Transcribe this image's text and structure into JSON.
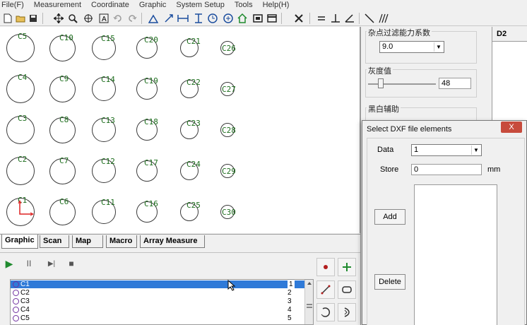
{
  "menu": [
    "File(F)",
    "Measurement",
    "Coordinate",
    "Graphic",
    "System Setup",
    "Tools",
    "Help(H)"
  ],
  "toolbar_icons": [
    "new-file-icon",
    "open-folder-icon",
    "save-icon",
    "move-icon",
    "zoom-icon",
    "fit-icon",
    "text-icon",
    "undo-icon",
    "redo-icon",
    "edit-point-icon",
    "align-icon",
    "distance-icon",
    "vertical-distance-icon",
    "rotate-icon",
    "mirror-icon",
    "home-icon",
    "rect-icon",
    "window-icon",
    "tools-icon",
    "line-icon",
    "perpendicular-icon",
    "angle-icon",
    "slash-icon",
    "parallel-icon"
  ],
  "canvas": {
    "labels": [
      "C5",
      "C10",
      "C15",
      "C20",
      "C21",
      "C26",
      "C4",
      "C9",
      "C14",
      "C19",
      "C22",
      "C27",
      "C3",
      "C8",
      "C13",
      "C18",
      "C23",
      "C28",
      "C2",
      "C7",
      "C12",
      "C17",
      "C24",
      "C29",
      "C1",
      "C6",
      "C11",
      "C16",
      "C25",
      "C30"
    ]
  },
  "tabs": [
    {
      "label": "Graphic",
      "active": true
    },
    {
      "label": "Scan"
    },
    {
      "label": "Map"
    },
    {
      "label": "Macro"
    },
    {
      "label": "Array Measure"
    }
  ],
  "player": {
    "play_icon": "▶",
    "pause_icon": "II",
    "step_icon": "▶|",
    "stop_icon": "■"
  },
  "element_list": [
    {
      "name": "C1",
      "index": "1",
      "selected": true
    },
    {
      "name": "C2",
      "index": "2"
    },
    {
      "name": "C3",
      "index": "3"
    },
    {
      "name": "C4",
      "index": "4"
    },
    {
      "name": "C5",
      "index": "5"
    }
  ],
  "settings": {
    "filter_title": "杂点过滤能力系数",
    "filter_value": "9.0",
    "gray_title": "灰度值",
    "gray_value": "48",
    "bw_title": "黑白辅助"
  },
  "d2": {
    "title": "D2"
  },
  "dialog": {
    "title": "Select DXF file elements",
    "close": "X",
    "data_label": "Data",
    "data_value": "1",
    "store_label": "Store",
    "store_value": "0",
    "unit": "mm",
    "add_button": "Add",
    "delete_button": "Delete"
  },
  "colors": {
    "label_green": "#1e6e1e",
    "selection_blue": "#2f7ad8",
    "close_red": "#c74b3c",
    "play_green": "#1f8a2e"
  }
}
